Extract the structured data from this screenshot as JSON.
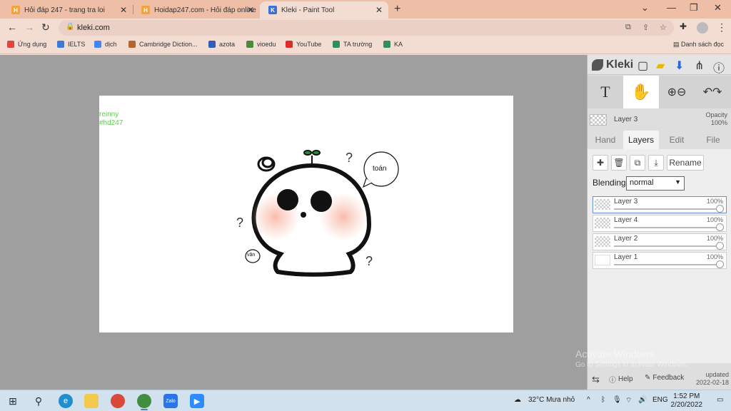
{
  "browser": {
    "tabs": [
      {
        "title": "Hỏi đáp 247 - trang tra loi",
        "icon": "hoidap-favicon",
        "color": "#f2a33a"
      },
      {
        "title": "Hoidap247.com - Hỏi đáp online",
        "icon": "hoidap-favicon",
        "color": "#f2a33a"
      },
      {
        "title": "Kleki - Paint Tool",
        "icon": "kleki-favicon",
        "color": "#3b6fd9"
      }
    ],
    "url": "kleki.com",
    "bookmarks": [
      {
        "label": "Ứng dụng",
        "color": "#e0443a"
      },
      {
        "label": "IELTS",
        "color": "#3b7ad9"
      },
      {
        "label": "dịch",
        "color": "#4285f4"
      },
      {
        "label": "Cambridge Diction...",
        "color": "#b5652b"
      },
      {
        "label": "azota",
        "color": "#2f5db8"
      },
      {
        "label": "vioedu",
        "color": "#4b8a3b"
      },
      {
        "label": "YouTube",
        "color": "#e02a2a"
      },
      {
        "label": "TA trường",
        "color": "#2f8f5d"
      },
      {
        "label": "KA",
        "color": "#2f8f5d"
      }
    ],
    "reading_list": "Danh sách đọc"
  },
  "canvas": {
    "tag_line1": "reinny",
    "tag_line2": "#hd247",
    "bubble_text": "toán",
    "van_text": "văn"
  },
  "panel": {
    "logo": "Kleki",
    "current_layer": "Layer 3",
    "opacity_label": "Opacity",
    "opacity_value": "100%",
    "tabs": [
      "Hand",
      "Layers",
      "Edit",
      "File"
    ],
    "rename": "Rename",
    "blending_label": "Blending",
    "blending_value": "normal",
    "layers": [
      {
        "name": "Layer 3",
        "opacity": "100%",
        "fill": 1.0,
        "selected": true
      },
      {
        "name": "Layer 4",
        "opacity": "100%",
        "fill": 1.0,
        "selected": false
      },
      {
        "name": "Layer 2",
        "opacity": "100%",
        "fill": 1.0,
        "selected": false
      },
      {
        "name": "Layer 1",
        "opacity": "100%",
        "fill": 1.0,
        "selected": false
      }
    ],
    "help": "Help",
    "feedback": "Feedback",
    "updated_label": "updated",
    "updated_date": "2022-02-18"
  },
  "watermark": {
    "line1": "Activate Windows",
    "line2": "Go to Settings to activate Windows."
  },
  "taskbar": {
    "weather": "32°C Mưa nhỏ",
    "lang": "ENG",
    "time": "1:52 PM",
    "date": "2/20/2022"
  }
}
